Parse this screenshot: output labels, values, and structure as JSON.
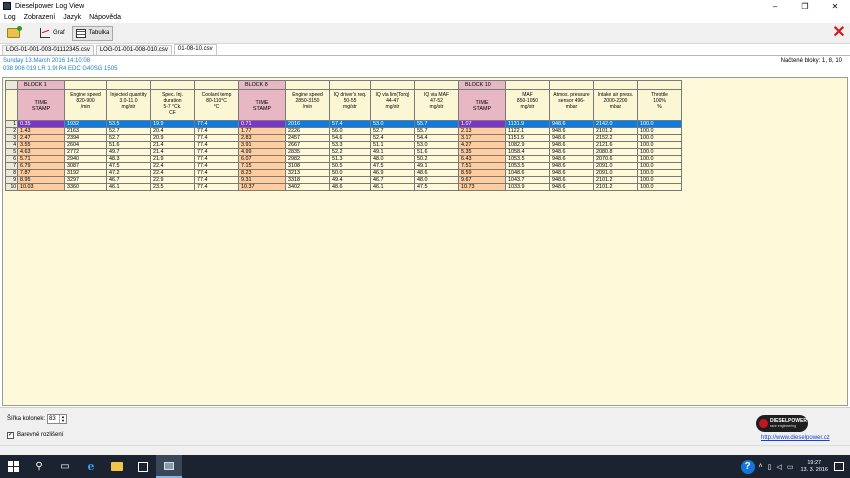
{
  "window": {
    "title": "Dieselpower Log View",
    "minimize": "–",
    "maximize": "❐",
    "close": "✕"
  },
  "menu": [
    "Log",
    "Zobrazení",
    "Jazyk",
    "Nápověda"
  ],
  "toolbar": {
    "open_label": "",
    "graph_label": "Graf",
    "table_label": "Tabulka",
    "close_label": "✕"
  },
  "file_tabs": [
    "LOG-01-001-003-01112345.csv",
    "LOG-01-001-008-010.csv",
    "01-08-10.csv"
  ],
  "info": {
    "date_line": "Sunday 13.March 2016 14:10:08",
    "ecu_line": "038 906 019 LR  1.9l R4 EDC G40SG  1505",
    "blocks_read": "Načtené bloky: 1, 8, 10"
  },
  "grid": {
    "blocks": [
      "BLOCK 1",
      "BLOCK 8",
      "BLOCK 10"
    ],
    "headers": [
      [
        "TIME",
        "STAMP"
      ],
      [
        "Engine speed",
        "820-900",
        "/min"
      ],
      [
        "Injected quantity",
        "3.0-11.0",
        "mg/str"
      ],
      [
        "Spec. Inj.",
        "duration",
        "5-7 °Ck.",
        "CF"
      ],
      [
        "Coolant temp",
        "80-110°C",
        "°C"
      ],
      [
        "TIME",
        "STAMP"
      ],
      [
        "Engine speed",
        "2850-3150",
        "/min"
      ],
      [
        "IQ driver's req.",
        "50-55",
        "mg/str"
      ],
      [
        "IQ via lim(Torq)",
        "44-47",
        "mg/str"
      ],
      [
        "IQ via MAF",
        "47-52",
        "mg/str"
      ],
      [
        "TIME",
        "STAMP"
      ],
      [
        "MAF",
        "850-1050",
        "mg/str"
      ],
      [
        "Atmos. pressure",
        "sensor 496-",
        "mbar"
      ],
      [
        "Intake air press.",
        "2000-2200",
        "mbar"
      ],
      [
        "Throttle",
        "100%",
        "%"
      ]
    ],
    "rows": [
      [
        "1",
        "0.35",
        "1932",
        "53.5",
        "19.9",
        "77.4",
        "0.71",
        "2016",
        "57.4",
        "53.0",
        "55.7",
        "1.07",
        "1131.9",
        "948.6",
        "2142.0",
        "100.0"
      ],
      [
        "2",
        "1.43",
        "2163",
        "52.7",
        "20.4",
        "77.4",
        "1.77",
        "2226",
        "56.0",
        "52.7",
        "55.7",
        "2.13",
        "1122.1",
        "948.6",
        "2101.2",
        "100.0"
      ],
      [
        "3",
        "2.47",
        "2394",
        "52.7",
        "20.9",
        "77.4",
        "2.83",
        "2457",
        "54.6",
        "52.4",
        "54.4",
        "3.17",
        "1151.5",
        "948.6",
        "2152.2",
        "100.0"
      ],
      [
        "4",
        "3.55",
        "2604",
        "51.6",
        "21.4",
        "77.4",
        "3.91",
        "2667",
        "53.3",
        "51.1",
        "53.0",
        "4.27",
        "1082.9",
        "948.6",
        "2121.6",
        "100.0"
      ],
      [
        "5",
        "4.63",
        "2772",
        "49.7",
        "21.4",
        "77.4",
        "4.99",
        "2835",
        "52.2",
        "49.1",
        "51.6",
        "5.35",
        "1058.4",
        "948.6",
        "2080.8",
        "100.0"
      ],
      [
        "6",
        "5.71",
        "2940",
        "48.3",
        "21.9",
        "77.4",
        "6.07",
        "2982",
        "51.3",
        "48.0",
        "50.2",
        "6.43",
        "1053.5",
        "948.6",
        "2070.6",
        "100.0"
      ],
      [
        "7",
        "6.79",
        "3087",
        "47.5",
        "22.4",
        "77.4",
        "7.15",
        "3108",
        "50.5",
        "47.5",
        "49.1",
        "7.51",
        "1053.5",
        "948.6",
        "2091.0",
        "100.0"
      ],
      [
        "8",
        "7.87",
        "3192",
        "47.2",
        "22.4",
        "77.4",
        "8.23",
        "3213",
        "50.0",
        "46.9",
        "48.6",
        "8.59",
        "1048.6",
        "948.6",
        "2091.0",
        "100.0"
      ],
      [
        "9",
        "8.95",
        "3297",
        "46.7",
        "22.9",
        "77.4",
        "9.31",
        "3318",
        "49.4",
        "46.7",
        "48.0",
        "9.67",
        "1043.7",
        "948.6",
        "2101.2",
        "100.0"
      ],
      [
        "10",
        "10.03",
        "3360",
        "46.1",
        "23.5",
        "77.4",
        "10.37",
        "3402",
        "48.6",
        "46.1",
        "47.5",
        "10.73",
        "1033.9",
        "948.6",
        "2101.2",
        "100.0"
      ]
    ]
  },
  "bottom": {
    "col_width_label": "Šířka kolonek:",
    "col_width_value": "83",
    "color_check_label": "Barevné rozlišení",
    "logo_text": "DIESELPOWER",
    "logo_sub": "race engineering",
    "link": "http://www.dieselpower.cz"
  },
  "taskbar": {
    "time": "19:27",
    "date": "13. 3. 2016",
    "help": "?"
  }
}
